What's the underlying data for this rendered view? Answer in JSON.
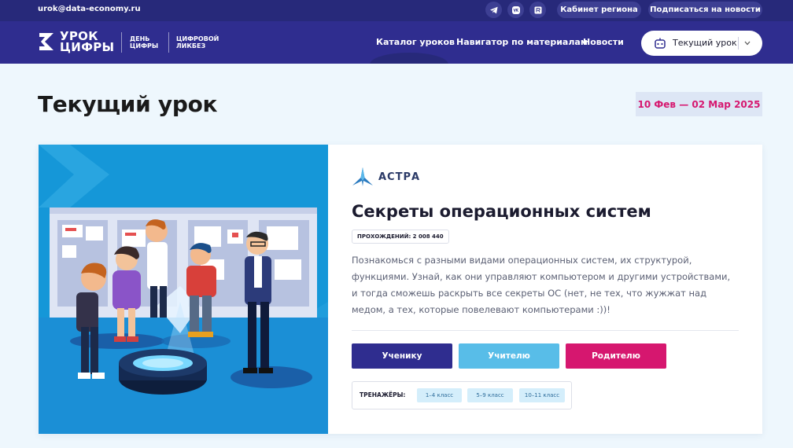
{
  "topbar": {
    "email": "urok@data-economy.ru",
    "social": [
      {
        "icon": "telegram-icon"
      },
      {
        "icon": "vk-icon"
      },
      {
        "icon": "rutube-icon"
      }
    ],
    "region_cabinet_label": "Кабинет региона",
    "subscribe_label": "Подписаться на новости"
  },
  "header": {
    "logo_line1": "УРОК",
    "logo_line2": "ЦИФРЫ",
    "sub1_line1": "ДЕНЬ",
    "sub1_line2": "ЦИФРЫ",
    "sub2_line1": "ЦИФРОВОЙ",
    "sub2_line2": "ЛИКБЕЗ",
    "nav": [
      {
        "label": "Каталог уроков"
      },
      {
        "label": "Навигатор по материалам"
      },
      {
        "label": "Новости"
      }
    ],
    "current_lesson_label": "Текущий урок"
  },
  "page": {
    "title": "Текущий урок",
    "date_range": "10 Фев — 02 Мар 2025"
  },
  "lesson": {
    "partner": "АСТРА",
    "title": "Секреты операционных систем",
    "passes": "ПРОХОЖДЕНИЙ: 2 008 440",
    "description": "Познакомься с разными видами операционных систем, их структурой, функциями. Узнай, как они управляют компьютером и другими устройствами, и тогда сможешь раскрыть все секреты ОС (нет, не тех, что жужжат над медом, а тех, которые повелевают компьютерами :))!",
    "roles": [
      {
        "label": "Ученику",
        "color": "#2f2d8f"
      },
      {
        "label": "Учителю",
        "color": "#58bde8"
      },
      {
        "label": "Родителю",
        "color": "#d6176f"
      }
    ],
    "trainers_label": "ТРЕНАЖЁРЫ:",
    "trainers": [
      {
        "label": "1–4 класс"
      },
      {
        "label": "5–9 класс"
      },
      {
        "label": "10–11 класс"
      }
    ]
  },
  "colors": {
    "topbar": "#27297a",
    "header": "#2f2d8f",
    "accent_pink": "#d6176f",
    "illustration_bg": "#1597d8"
  }
}
